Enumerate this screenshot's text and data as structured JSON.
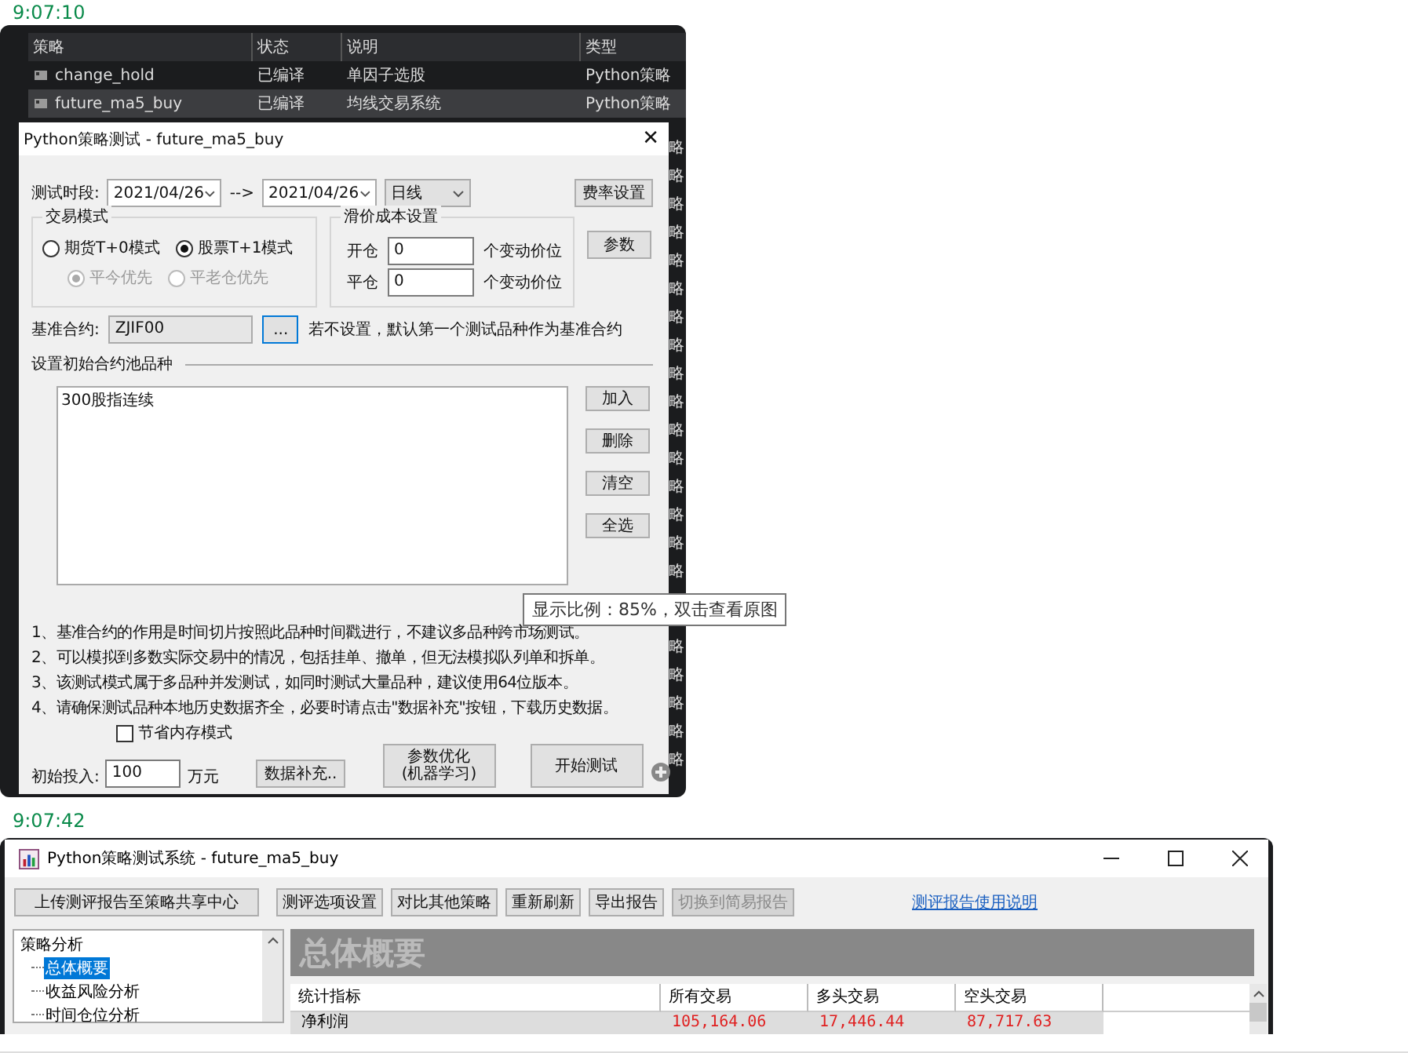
{
  "messages": [
    {
      "time": "9:07:10",
      "kind": "strategy_dialog",
      "strategy_list": {
        "columns": [
          "策略",
          "状态",
          "说明",
          "类型"
        ],
        "rows": [
          {
            "name": "change_hold",
            "status": "已编译",
            "description": "单因子选股",
            "type": "Python策略",
            "selected": false
          },
          {
            "name": "future_ma5_buy",
            "status": "已编译",
            "description": "均线交易系统",
            "type": "Python策略",
            "selected": true
          }
        ],
        "more_type_cells": [
          "略",
          "略",
          "略",
          "略",
          "略",
          "略",
          "略",
          "略",
          "略",
          "略",
          "略",
          "略",
          "略",
          "略",
          "略",
          "略",
          "略",
          "略",
          "略",
          "略",
          "略"
        ]
      },
      "dialog": {
        "title": "Python策略测试 - future_ma5_buy",
        "close": "✕",
        "period_label": "测试时段:",
        "start_date": "2021/04/26",
        "arrow": "-->",
        "end_date": "2021/04/26",
        "period": "日线",
        "fee_button": "费率设置",
        "trade_mode": {
          "title": "交易模式",
          "options": [
            {
              "label": "期货T+0模式",
              "selected": false
            },
            {
              "label": "股票T+1模式",
              "selected": true
            }
          ],
          "sub_options": [
            {
              "label": "平今优先",
              "selected": true,
              "disabled": true
            },
            {
              "label": "平老仓优先",
              "selected": false,
              "disabled": true
            }
          ]
        },
        "slippage": {
          "title": "滑价成本设置",
          "rows": [
            {
              "label": "开仓",
              "value": "0",
              "unit": "个变动价位"
            },
            {
              "label": "平仓",
              "value": "0",
              "unit": "个变动价位"
            }
          ]
        },
        "params_button": "参数",
        "benchmark": {
          "label": "基准合约:",
          "value": "ZJIF00",
          "browse": "...",
          "hint": "若不设置，默认第一个测试品种作为基准合约"
        },
        "pool": {
          "title": "设置初始合约池品种",
          "items": [
            "300股指连续"
          ],
          "buttons": [
            "加入",
            "删除",
            "清空",
            "全选"
          ]
        },
        "notes": [
          "1、基准合约的作用是时间切片按照此品种时间戳进行，不建议多品种跨市场测试。",
          "2、可以模拟到多数实际交易中的情况，包括挂单、撤单，但无法模拟队列单和拆单。",
          "3、该测试模式属于多品种并发测试，如同时测试大量品种，建议使用64位版本。",
          "4、请确保测试品种本地历史数据齐全，必要时请点击\"数据补充\"按钮，下载历史数据。"
        ],
        "save_memory": {
          "label": "节省内存模式",
          "checked": false
        },
        "initial": {
          "label": "初始投入:",
          "value": "100",
          "unit": "万元"
        },
        "data_button": "数据补充..",
        "optimize_button": "参数优化\n(机器学习)",
        "start_button": "开始测试"
      },
      "tooltip": "显示比例：85%，双击查看原图"
    },
    {
      "time": "9:07:42",
      "kind": "report_window",
      "window": {
        "title": "Python策略测试系统 - future_ma5_buy"
      },
      "upload_button": "上传测评报告至策略共享中心",
      "toolbar": [
        {
          "label": "测评选项设置",
          "disabled": false
        },
        {
          "label": "对比其他策略",
          "disabled": false
        },
        {
          "label": "重新刷新",
          "disabled": false
        },
        {
          "label": "导出报告",
          "disabled": false
        },
        {
          "label": "切换到简易报告",
          "disabled": true
        }
      ],
      "help_link": "测评报告使用说明",
      "tree": {
        "label": "策略分析",
        "children": [
          {
            "label": "总体概要",
            "selected": true
          },
          {
            "label": "收益风险分析",
            "selected": false
          },
          {
            "label": "时间仓位分析",
            "selected": false
          }
        ]
      },
      "banner": "总体概要",
      "table": {
        "columns": [
          "统计指标",
          "所有交易",
          "多头交易",
          "空头交易"
        ],
        "rows": [
          {
            "cells": [
              "净利润",
              "105,164.06",
              "17,446.44",
              "87,717.63"
            ]
          }
        ]
      }
    }
  ]
}
